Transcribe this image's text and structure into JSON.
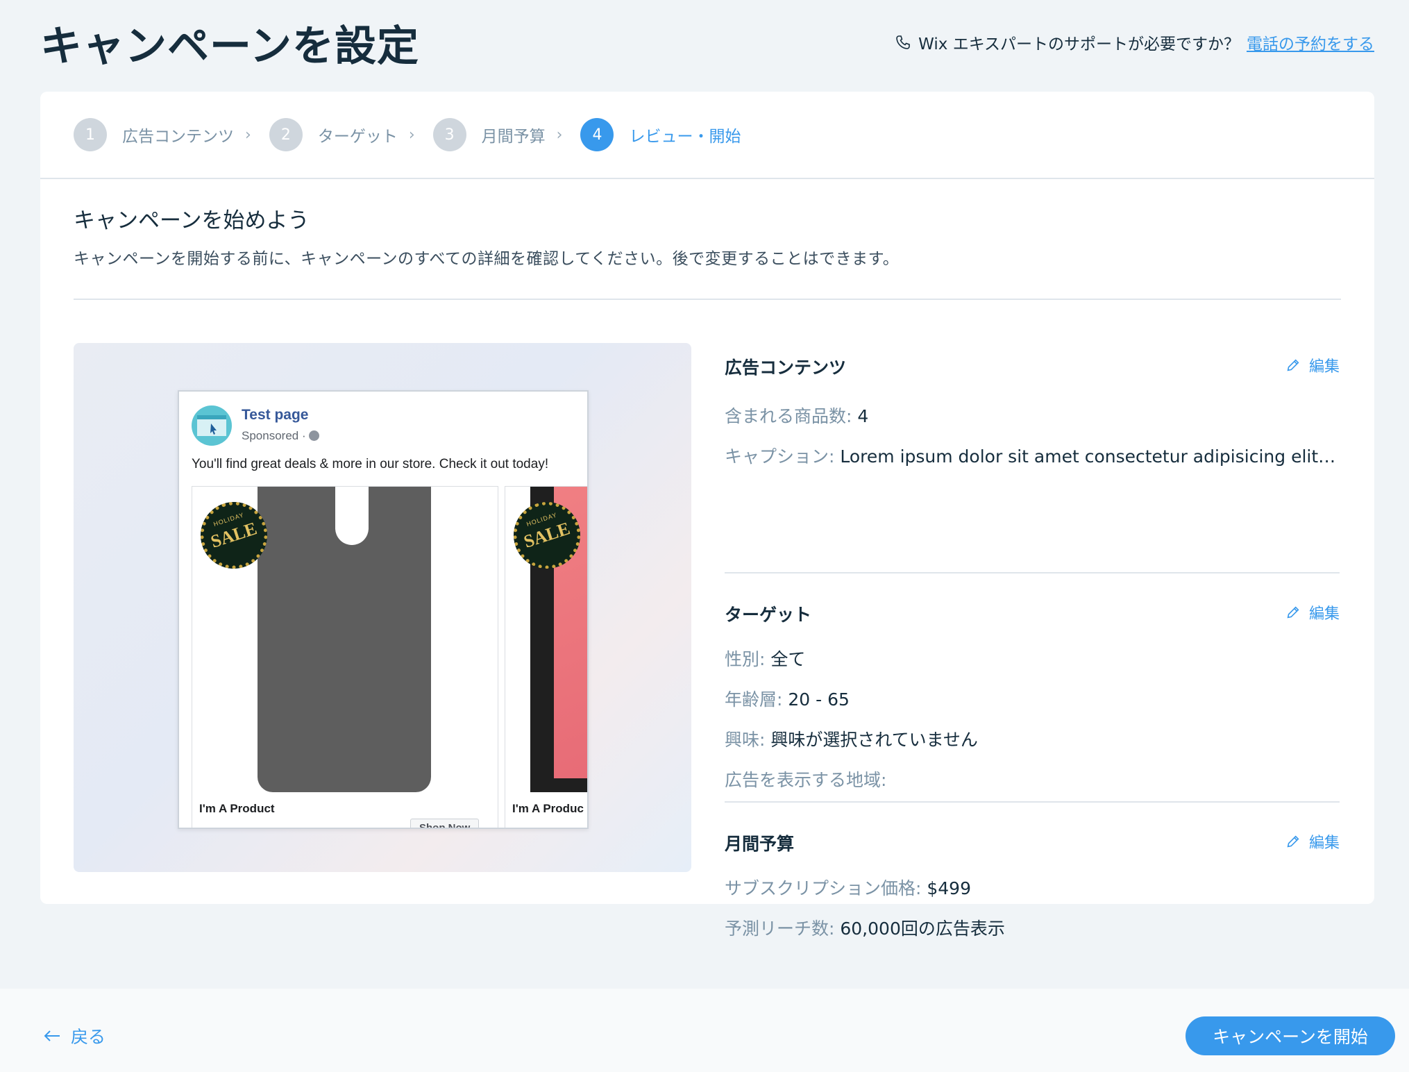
{
  "header": {
    "title": "キャンペーンを設定",
    "support_text": "Wix エキスパートのサポートが必要ですか？",
    "support_link": "電話の予約をする"
  },
  "stepper": {
    "steps": [
      {
        "number": "1",
        "label": "広告コンテンツ",
        "state": "done"
      },
      {
        "number": "2",
        "label": "ターゲット",
        "state": "done"
      },
      {
        "number": "3",
        "label": "月間予算",
        "state": "done"
      },
      {
        "number": "4",
        "label": "レビュー・開始",
        "state": "active"
      }
    ]
  },
  "intro": {
    "heading": "キャンペーンを始めよう",
    "description": "キャンペーンを開始する前に、キャンペーンのすべての詳細を確認してください。後で変更することはできます。"
  },
  "ad_preview": {
    "page_name": "Test page",
    "sponsored": "Sponsored · ",
    "text": "You'll find great deals & more in our store. Check it out today!",
    "items": [
      {
        "title": "I'm A Product",
        "button": "Shop Now",
        "badge_top": "HOLIDAY",
        "badge": "SALE"
      },
      {
        "title": "I'm A Produc",
        "badge_top": "HOLIDAY",
        "badge": "SALE"
      }
    ]
  },
  "summary": {
    "edit_label": "編集",
    "ad_content": {
      "title": "広告コンテンツ",
      "products_key": "含まれる商品数: ",
      "products_value": "4",
      "caption_key": "キャプション: ",
      "caption_value": "Lorem ipsum dolor sit amet consectetur adipisicing elit. Re..."
    },
    "target": {
      "title": "ターゲット",
      "gender_key": "性別: ",
      "gender_value": "全て",
      "age_key": "年齢層: ",
      "age_value": "20 - 65",
      "interest_key": "興味: ",
      "interest_value": "興味が選択されていません",
      "location_key": "広告を表示する地域: ",
      "location_value": ""
    },
    "budget": {
      "title": "月間予算",
      "price_key": "サブスクリプション価格: ",
      "price_value": "$499",
      "reach_key": "予測リーチ数: ",
      "reach_value": "60,000回の広告表示"
    }
  },
  "footer": {
    "back_label": "戻る",
    "launch_label": "キャンペーンを開始"
  },
  "colors": {
    "accent": "#3899ec",
    "text": "#162d3d",
    "muted": "#7a92a5",
    "background": "#f0f4f7"
  }
}
